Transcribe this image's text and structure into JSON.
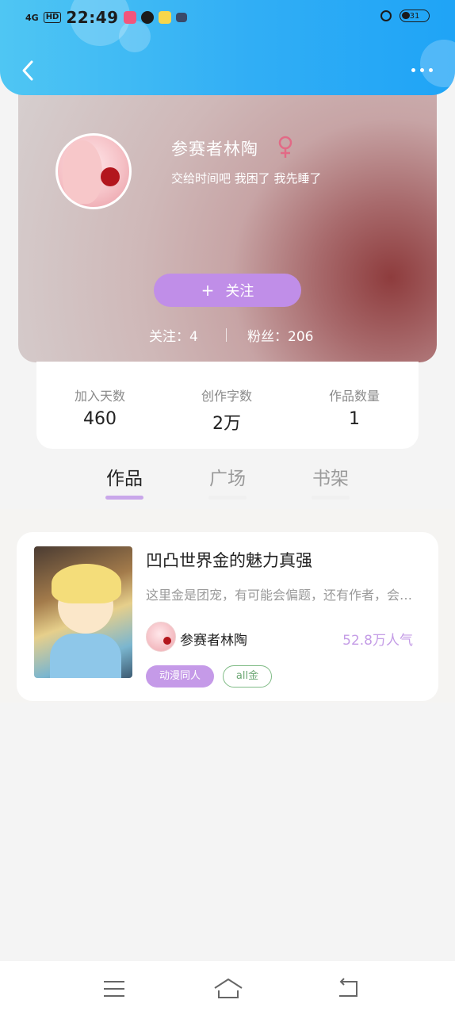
{
  "status_bar": {
    "signal": "4G",
    "hd": "HD",
    "time": "22:49",
    "battery": "31",
    "app_icon_colors": [
      "#f2557c",
      "#1b1b1b",
      "#f7d64c"
    ]
  },
  "header": {
    "back_icon": "chevron-left-icon",
    "more_icon": "more-dots-icon",
    "gradient_colors": [
      "#4fc6f3",
      "#1fa4f6"
    ]
  },
  "profile": {
    "username": "参赛者林陶",
    "gender_icon": "female-icon",
    "bio": "交给时间吧 我困了 我先睡了",
    "follow_button": {
      "plus": "+",
      "label": "关注"
    },
    "following_text": "关注：4",
    "fans_text": "粉丝：206"
  },
  "stats": [
    {
      "label": "加入天数",
      "value": "460"
    },
    {
      "label": "创作字数",
      "value": "2万"
    },
    {
      "label": "作品数量",
      "value": "1"
    }
  ],
  "tabs": [
    {
      "label": "作品",
      "active": true
    },
    {
      "label": "广场",
      "active": false
    },
    {
      "label": "书架",
      "active": false
    }
  ],
  "work": {
    "title": "凹凸世界金的魅力真强",
    "description": "这里金是团宠，有可能会偏题，还有作者，会更新",
    "author": "参赛者林陶",
    "popularity": "52.8万人气",
    "tags": [
      "动漫同人",
      "all金"
    ]
  },
  "system_nav": {
    "icons": [
      "menu-icon",
      "home-icon",
      "back-icon"
    ]
  },
  "colors": {
    "accent_purple": "#c08ee8",
    "tag_green": "#7fbb85",
    "popularity_purple": "#c49ce6"
  }
}
